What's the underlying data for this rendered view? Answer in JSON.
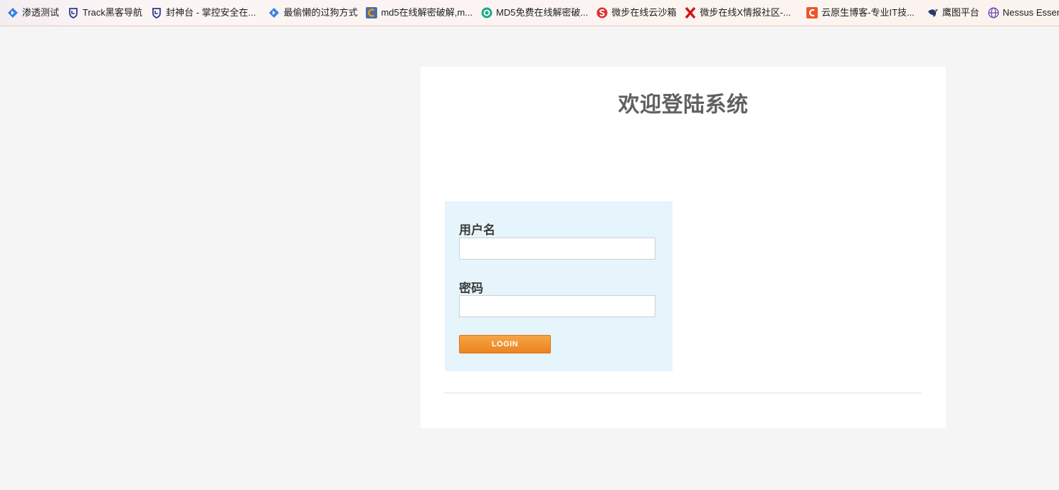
{
  "bookmarks": [
    {
      "label": "渗透测试",
      "icon": "diamond-arrow-icon"
    },
    {
      "label": "Track黑客导航",
      "icon": "shield-icon"
    },
    {
      "label": "封神台 - 掌控安全在...",
      "icon": "shield-icon"
    },
    {
      "label": "最偷懒的过狗方式",
      "icon": "diamond-arrow-icon"
    },
    {
      "label": "md5在线解密破解,m...",
      "icon": "c-logo-icon"
    },
    {
      "label": "MD5免费在线解密破...",
      "icon": "cycle-logo-icon"
    },
    {
      "label": "微步在线云沙箱",
      "icon": "s-logo-icon"
    },
    {
      "label": "微步在线X情报社区-...",
      "icon": "x-logo-icon"
    },
    {
      "label": "云原生博客-专业IT技...",
      "icon": "c-square-icon"
    },
    {
      "label": "鹰图平台",
      "icon": "eagle-icon"
    },
    {
      "label": "Nessus Essentials / F...",
      "icon": "globe-icon"
    }
  ],
  "login": {
    "title": "欢迎登陆系统",
    "username_label": "用户名",
    "username_value": "",
    "password_label": "密码",
    "password_value": "",
    "button_label": "LOGIN"
  },
  "colors": {
    "page_bg": "#f5f5f5",
    "panel_bg": "#ffffff",
    "form_bg": "#e6f4fb",
    "button": "#ee8a26",
    "title": "#606060"
  }
}
